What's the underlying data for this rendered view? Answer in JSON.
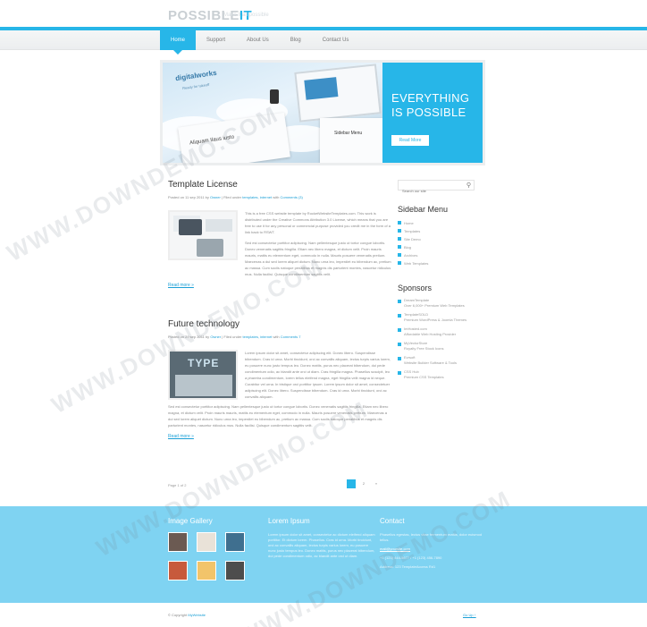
{
  "header": {
    "logo_main": "POSSIBLE",
    "logo_accent": "IT",
    "tagline": "Make it all possible"
  },
  "nav": {
    "items": [
      "Home",
      "Support",
      "About Us",
      "Blog",
      "Contact Us"
    ],
    "active_index": 0
  },
  "hero": {
    "image_logo": "digitalworks",
    "image_sub": "Ready for takeoff",
    "image_caption": "Aliquam Ilaus iusto",
    "image_menu": "Sidebar Menu",
    "headline": "EVERYTHING IS POSSIBLE",
    "button": "Read More"
  },
  "posts": [
    {
      "title": "Template License",
      "meta_prefix": "Posted on 11 sep 2011 by",
      "author": "Owner",
      "meta_mid": "| Filed under",
      "tags": "templates, internet",
      "meta_with": "with",
      "comments": "Comments (3)",
      "text": "This is a free CSS website template by RocketWebsiteTemplates.com. This work is distributed under the Creative Commons Attribution 3.0 License, which means that you are free to use it for any personal or commercial purpose provided you credit me in the form of a link back to RSWT.",
      "text2": "Sed est consectetur porttitor adipiscing. Nam pellentesque justo ut tortor congue lobortis. Donec venenatis sagittis fringilla. Etiam nec libero magna, et dictum velit. Proin mauris mauris, mattis eu elementum eget, commodo in nulla. Mauris posuere venenatis pretium. Maecenas a dui sed lorem aliquet dictum. Nunc urna leo, imperdiet eu bibendum ac, pretium ac massa. Cum sociis natoque penatibus et magnis dis parturient montes, nascetur ridiculus mus. Nulla facilisi. Quisque condimentum sagittis velit.",
      "read_more": "Read more »"
    },
    {
      "title": "Future technology",
      "meta_prefix": "Posted on 29 sep 2011 by",
      "author": "Owner",
      "meta_mid": "| Filed under",
      "tags": "templates, internet",
      "meta_with": "with",
      "comments": "Comments 7",
      "text": "Lorem ipsum dolor sit amet, consectetur adipiscing elit. Donec libero. Suspendisse bibendum. Cras id urna. Morbi tincidunt, orci ac convallis aliquam, lectus turpis varius lorem, eu posuere nunc justo tempus leo. Donec mattis, purus nec placerat bibendum, dui pede condimentum odio, ac blandit ante orci ut diam. Cras fringilla magna. Phasellus suscipit, leo a pharetra condimentum, lorem tellus eleifend magna, eget fringilla velit magna id neque. Curabitur vel urna. In tristique orci porttitor ipsum. Lorem ipsum dolor sit amet, consectetuer adipiscing elit. Donec libero. Suspendisse bibendum. Cras id urna. Morbi tincidunt, orci ac convallis aliquam.",
      "text2": "Sed est consectetur porttitor adipiscing. Nam pellentesque justo ut tortor congue lobortis. Donec venenatis sagittis fringilla. Etiam nec libero magna, et dictum velit. Proin mauris mauris, mattis eu elementum eget, commodo in nulla. Mauris posuere venenatis pretium. Maecenas a dui sed lorem aliquet dictum. Nunc urna leo, imperdiet eu bibendum ac, pretium ac massa. Cum sociis natoque penatibus et magnis dis parturient montes, nascetur ridiculus mus. Nulla facilisi. Quisque condimentum sagittis velit.",
      "read_more": "Read more »",
      "thumb_word": "TYPE"
    }
  ],
  "pager": {
    "label": "Page 1 of 2",
    "pages": [
      "1",
      "2",
      "»"
    ]
  },
  "sidebar": {
    "search_placeholder": "Search our site",
    "menu_title": "Sidebar Menu",
    "menu_items": [
      "Home",
      "Templates",
      "Site Demo",
      "Blog",
      "Archives",
      "Web Templates"
    ],
    "sponsors_title": "Sponsors",
    "sponsors": [
      {
        "name": "DreamTemplate",
        "desc": "Over 6,000+ Premium Web Templates"
      },
      {
        "name": "TemplateSOLD",
        "desc": "Premium WordPress & Joomla Themes"
      },
      {
        "name": "ImHosted.com",
        "desc": "Affordable Web Hosting Provider"
      },
      {
        "name": "MyVectorStore",
        "desc": "Royalty Free Stock Icons"
      },
      {
        "name": "Evrsoft",
        "desc": "Website Builder Software & Tools"
      },
      {
        "name": "CSS Hub",
        "desc": "Premium CSS Templates"
      }
    ]
  },
  "footer": {
    "gallery_title": "Image Gallery",
    "gallery_colors": [
      "#6b5a52",
      "#e9e2d8",
      "#3f6f8f",
      "#c75a3c",
      "#f2c46a",
      "#4d4d4d"
    ],
    "lorem_title": "Lorem Ipsum",
    "lorem_text": "Lorem ipsum dolor sit amet, consectetur ac dictum eleifend aliquam porttitor. Et dictum lorem. Phasellus. Cras id urna. Morbi tincidunt, orci ac convallis aliquam, lectus turpis varius lorem, eu posuere nunc justo tempus leo. Donec mattis, purus nec placerat bibendum, dui pede condimentum odio, ac blandit ante orci ut diam.",
    "contact_title": "Contact",
    "contact_text": "Phasellus egestas, lectus vitae fermentum mattis, dolor euismod tellus.",
    "contact_email": "mail@yoursite.com",
    "contact_phone": "+1 (123) 444-5677 / +1 (123) 456-7890",
    "contact_address": "Address: 123 TemplateAccess Rd1"
  },
  "bottom": {
    "copyright": "© Copyright",
    "copyright_link": "MyWebsite",
    "top_link": "Go Up ↑"
  },
  "watermark": "WWW.DOWNDEMO.COM",
  "colors": {
    "accent": "#27b6e8",
    "footer_bg": "#7fd3f2"
  }
}
